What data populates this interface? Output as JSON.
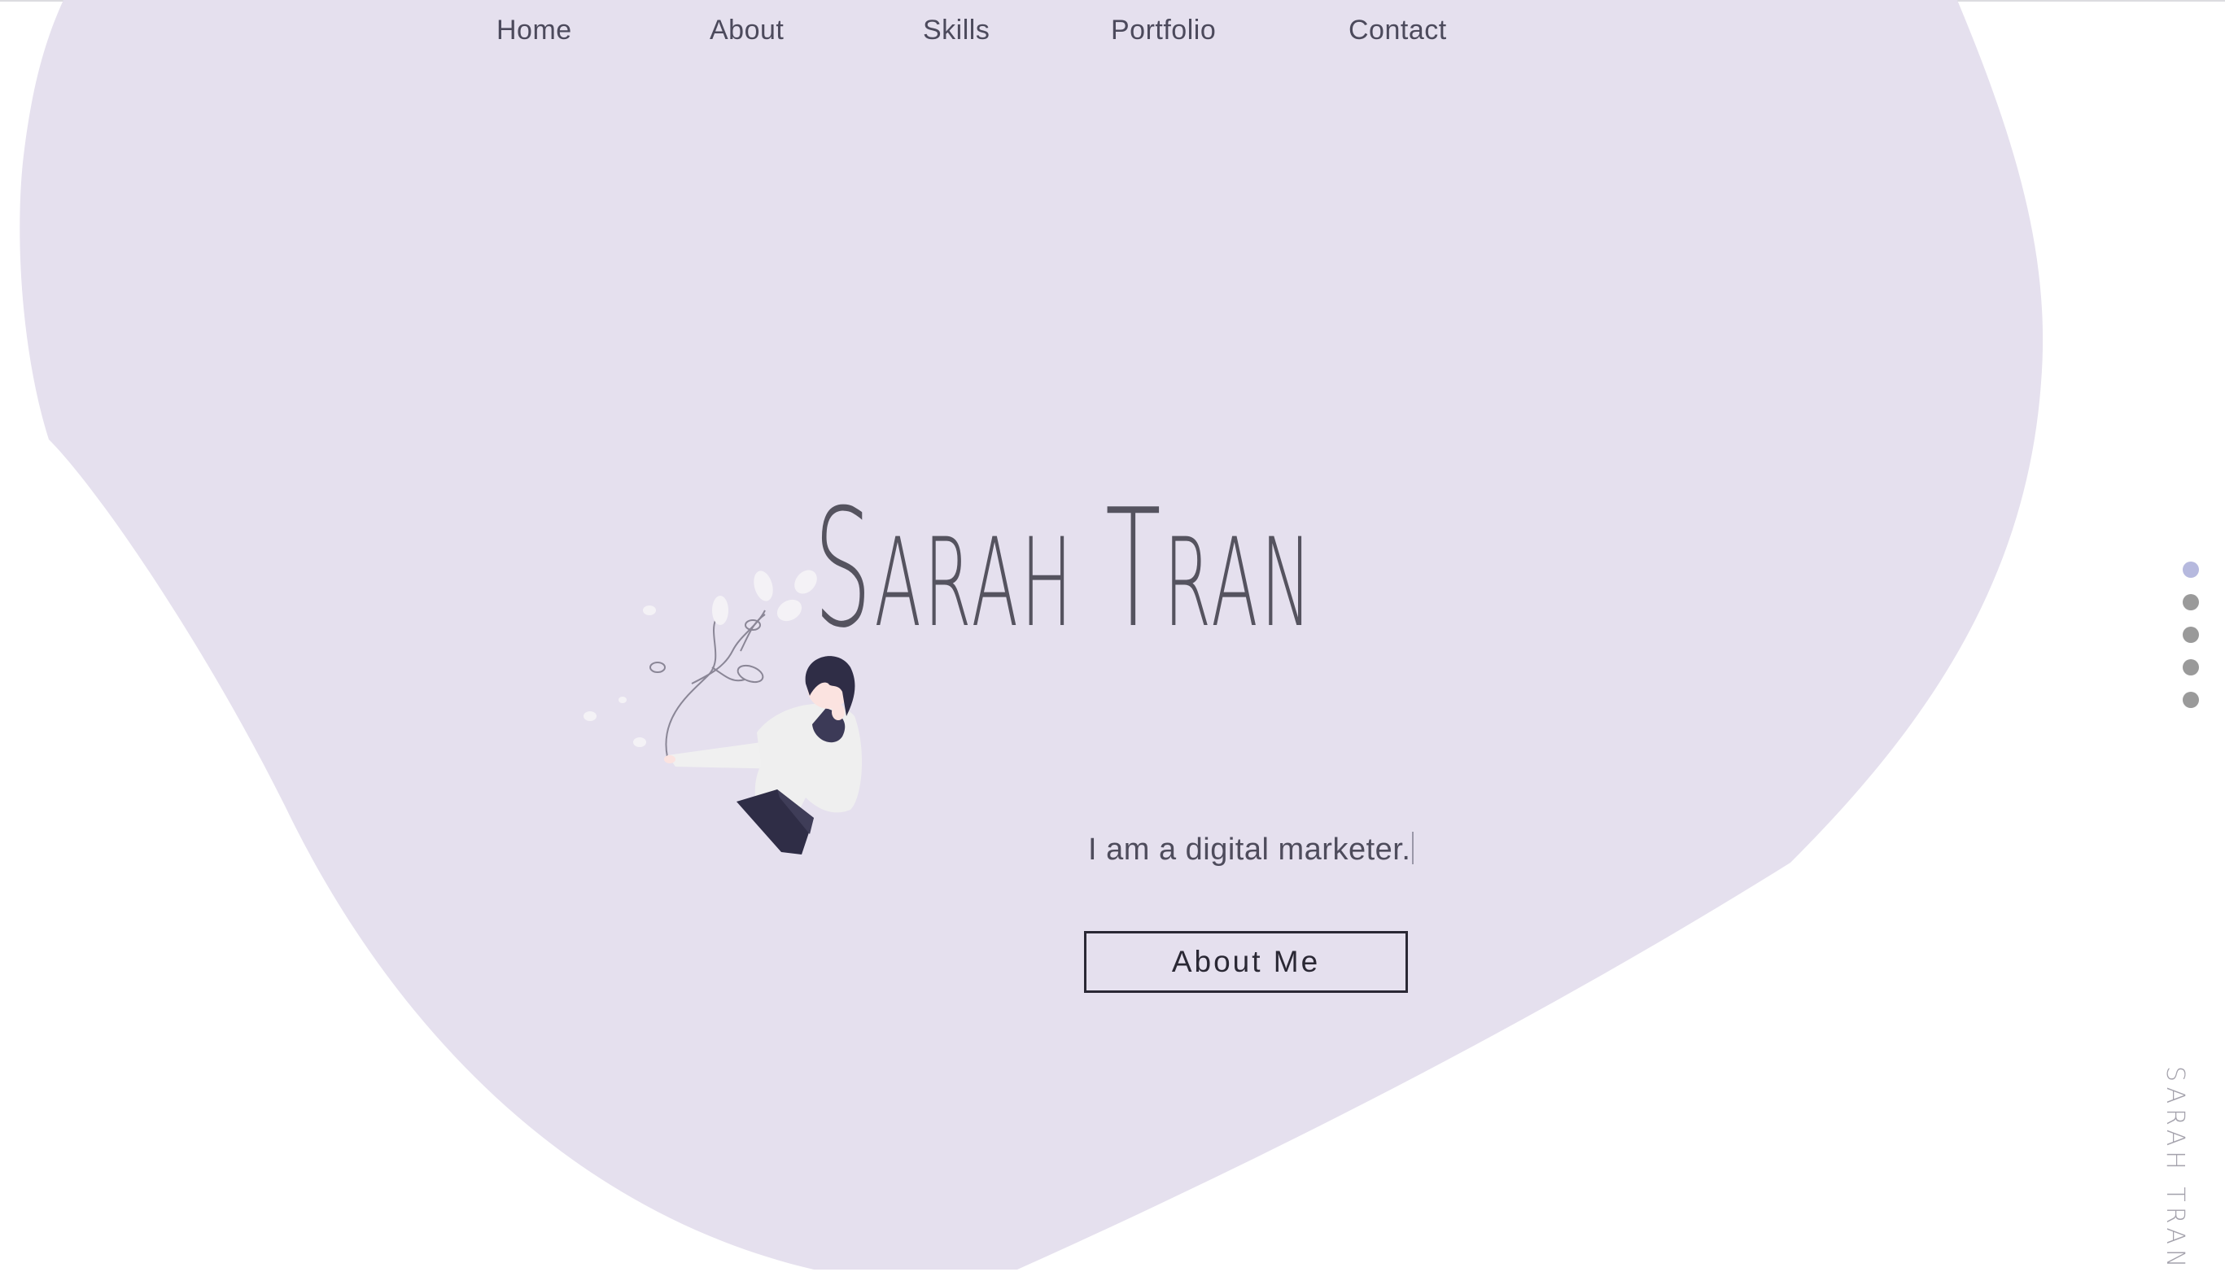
{
  "nav": {
    "items": [
      {
        "label": "Home"
      },
      {
        "label": "About"
      },
      {
        "label": "Skills"
      },
      {
        "label": "Portfolio"
      },
      {
        "label": "Contact"
      }
    ]
  },
  "hero": {
    "title_first": "Sarah",
    "title_last": "Tran",
    "tagline": "I am a digital marketer.",
    "button_label": "About Me",
    "illustration_icon": "girl-with-leaves-illustration"
  },
  "side_nav": {
    "sections": 5,
    "active_index": 0
  },
  "vertical_brand": "SARAH TRAN",
  "colors": {
    "blob": "#e5e0ee",
    "text": "#4c4a5c",
    "dot_active": "#b6b9de",
    "dot_inactive": "#9a9a9a",
    "button_border": "#2a2834"
  }
}
